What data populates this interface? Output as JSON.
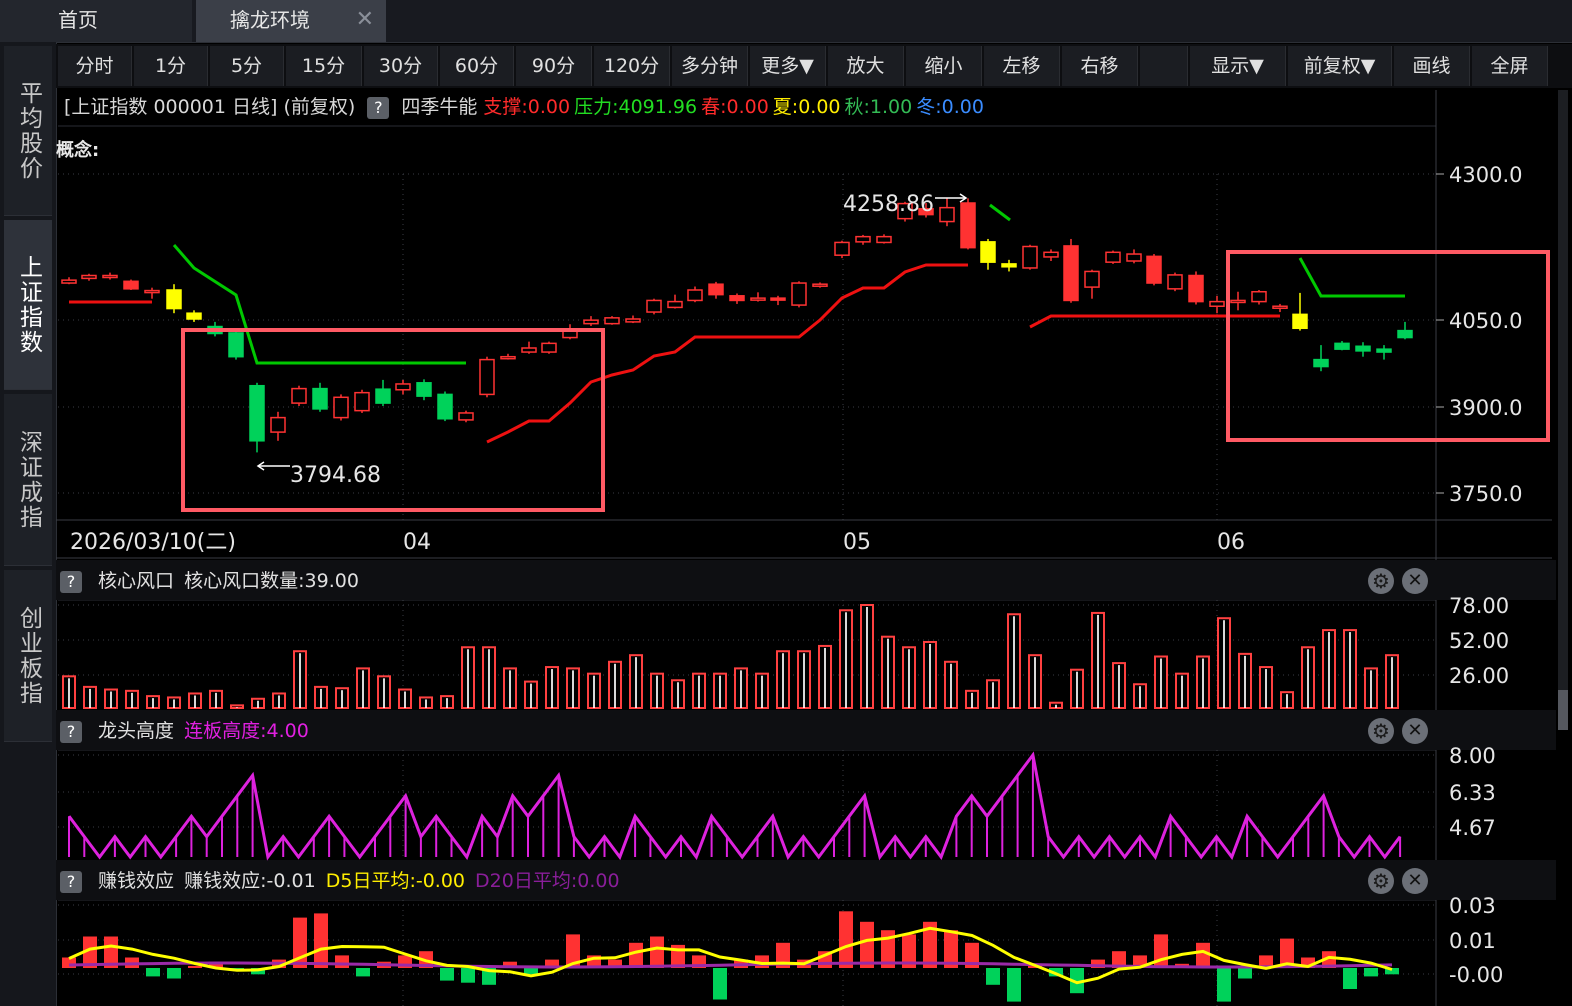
{
  "tabs": {
    "home": "首页",
    "active": "擒龙环境",
    "close": "✕"
  },
  "sidebar": [
    {
      "label": "平均股价",
      "active": false
    },
    {
      "label": "上证指数",
      "active": true
    },
    {
      "label": "深证成指",
      "active": false
    },
    {
      "label": "创业板指",
      "active": false
    }
  ],
  "toolbar": [
    "分时",
    "1分",
    "5分",
    "15分",
    "30分",
    "60分",
    "90分",
    "120分",
    "多分钟",
    "更多▼",
    "放大",
    "缩小",
    "左移",
    "右移",
    "",
    "显示▼",
    "前复权▼",
    "画线",
    "全屏"
  ],
  "header": {
    "symbol": "[上证指数 000001 日线]",
    "adj": "(前复权)",
    "help": "?",
    "indicator": "四季牛能",
    "support": "支撑:0.00",
    "pressure": "压力:4091.96",
    "spring": "春:0.00",
    "summer": "夏:0.00",
    "autumn": "秋:1.00",
    "winter": "冬:0.00"
  },
  "concept": "概念:",
  "colors": {
    "up": "#ff3232",
    "down": "#00d25a",
    "green_line": "#00c800",
    "red_line": "#ee1111",
    "yellow": "#ffff00",
    "magenta": "#dd22dd",
    "purple": "#9a2aa8",
    "box": "#ff5a64"
  },
  "price_chart": {
    "y_ticks": [
      "4300.0",
      "4050.0",
      "3900.0",
      "3750.0"
    ],
    "dates": [
      "2026/03/10(二)",
      "04",
      "05",
      "06"
    ],
    "high_label": "4258.86",
    "low_label": "3794.68"
  },
  "panel1": {
    "help": "?",
    "name": "核心风口",
    "stat": "核心风口数量:39.00",
    "ticks": [
      "78.00",
      "52.00",
      "26.00"
    ],
    "values": [
      24,
      16,
      14,
      13,
      9,
      8,
      11,
      13,
      2,
      7,
      11,
      43,
      16,
      15,
      30,
      24,
      14,
      8,
      9,
      46,
      46,
      30,
      20,
      31,
      30,
      26,
      35,
      40,
      26,
      21,
      26,
      26,
      30,
      26,
      43,
      43,
      47,
      74,
      78,
      54,
      46,
      50,
      35,
      13,
      21,
      71,
      40,
      4,
      29,
      72,
      34,
      18,
      39,
      26,
      39,
      68,
      41,
      31,
      12,
      46,
      59,
      59,
      30,
      40
    ]
  },
  "panel2": {
    "help": "?",
    "name": "龙头高度",
    "stat": "连板高度:4.00",
    "ticks": [
      "8.00",
      "6.33",
      "4.67"
    ],
    "values": [
      5,
      4,
      3,
      4,
      3,
      4,
      3,
      4,
      5,
      4,
      5,
      6,
      7,
      3,
      4,
      3,
      4,
      5,
      4,
      3,
      4,
      5,
      6,
      4,
      5,
      4,
      3,
      5,
      4,
      6,
      5,
      6,
      7,
      4,
      3,
      4,
      3,
      5,
      4,
      3,
      4,
      3,
      5,
      4,
      3,
      4,
      5,
      3,
      4,
      3,
      4,
      5,
      6,
      3,
      4,
      3,
      4,
      3,
      5,
      6,
      5,
      6,
      7,
      8,
      4,
      3,
      4,
      3,
      4,
      3,
      4,
      3,
      5,
      4,
      3,
      4,
      3,
      5,
      4,
      3,
      4,
      5,
      6,
      4,
      3,
      4,
      3,
      4
    ]
  },
  "panel3": {
    "help": "?",
    "name": "赚钱效应",
    "stat": "赚钱效应:-0.01",
    "d5": "D5日平均:-0.00",
    "d20": "D20日平均:0.00",
    "ticks": [
      "0.03",
      "0.01",
      "-0.00"
    ],
    "values": [
      0.005,
      0.015,
      0.015,
      0.005,
      -0.004,
      -0.005,
      0.001,
      0.003,
      -0.001,
      -0.003,
      0.004,
      0.024,
      0.026,
      0.006,
      -0.004,
      0.003,
      0.006,
      0.008,
      -0.006,
      -0.007,
      -0.008,
      0.003,
      -0.003,
      0.004,
      0.016,
      0.006,
      0.004,
      0.012,
      0.015,
      0.011,
      0.006,
      -0.015,
      0.004,
      0.006,
      0.012,
      0.004,
      0.008,
      0.027,
      0.022,
      0.018,
      0.016,
      0.022,
      0.018,
      0.012,
      -0.008,
      -0.016,
      0.001,
      -0.004,
      -0.012,
      0.004,
      0.008,
      0.006,
      0.016,
      0.002,
      0.012,
      -0.016,
      -0.005,
      0.006,
      0.014,
      0.005,
      0.008,
      -0.01,
      -0.004,
      -0.003
    ]
  }
}
